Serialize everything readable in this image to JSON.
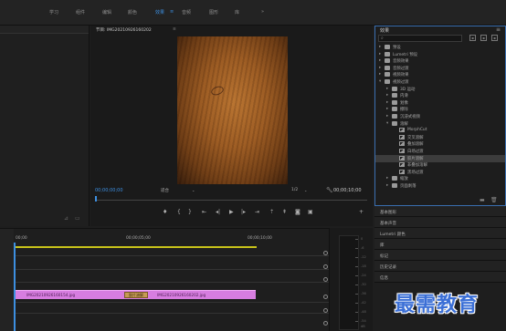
{
  "workspaces": [
    {
      "label": "学习",
      "active": false
    },
    {
      "label": "组件",
      "active": false
    },
    {
      "label": "编辑",
      "active": false
    },
    {
      "label": "颜色",
      "active": false
    },
    {
      "label": "效果",
      "active": true
    },
    {
      "label": "音频",
      "active": false
    },
    {
      "label": "图形",
      "active": false
    },
    {
      "label": "库",
      "active": false
    }
  ],
  "workspaces_more": "»",
  "monitor": {
    "tab_label": "节目: IMG20210926160202",
    "tab_close": "≡",
    "timecode_left": "00;00;00;00",
    "fit_label": "适合",
    "resolution_label": "1/2",
    "timecode_right": "00;00;10;00"
  },
  "effects": {
    "title": "效果",
    "menu": "≡",
    "search_value": "",
    "items": [
      {
        "level": 0,
        "type": "folder",
        "expanded": false,
        "label": "预设",
        "selected": false
      },
      {
        "level": 0,
        "type": "folder",
        "expanded": false,
        "label": "Lumetri 预设",
        "selected": false
      },
      {
        "level": 0,
        "type": "folder",
        "expanded": false,
        "label": "音频效果",
        "selected": false
      },
      {
        "level": 0,
        "type": "folder",
        "expanded": false,
        "label": "音频过渡",
        "selected": false
      },
      {
        "level": 0,
        "type": "folder",
        "expanded": false,
        "label": "视频效果",
        "selected": false
      },
      {
        "level": 0,
        "type": "folder",
        "expanded": true,
        "label": "视频过渡",
        "selected": false
      },
      {
        "level": 1,
        "type": "folder",
        "expanded": false,
        "label": "3D 运动",
        "selected": false
      },
      {
        "level": 1,
        "type": "folder",
        "expanded": false,
        "label": "内滑",
        "selected": false
      },
      {
        "level": 1,
        "type": "folder",
        "expanded": false,
        "label": "划像",
        "selected": false
      },
      {
        "level": 1,
        "type": "folder",
        "expanded": false,
        "label": "擦除",
        "selected": false
      },
      {
        "level": 1,
        "type": "folder",
        "expanded": false,
        "label": "沉浸式视频",
        "selected": false
      },
      {
        "level": 1,
        "type": "folder",
        "expanded": true,
        "label": "溶解",
        "selected": false
      },
      {
        "level": 2,
        "type": "transition",
        "expanded": false,
        "label": "MorphCut",
        "selected": false
      },
      {
        "level": 2,
        "type": "transition",
        "expanded": false,
        "label": "交叉溶解",
        "selected": false
      },
      {
        "level": 2,
        "type": "transition",
        "expanded": false,
        "label": "叠加溶解",
        "selected": false
      },
      {
        "level": 2,
        "type": "transition",
        "expanded": false,
        "label": "白场过渡",
        "selected": false
      },
      {
        "level": 2,
        "type": "transition",
        "expanded": false,
        "label": "胶片溶解",
        "selected": true
      },
      {
        "level": 2,
        "type": "transition",
        "expanded": false,
        "label": "非叠加溶解",
        "selected": false
      },
      {
        "level": 2,
        "type": "transition",
        "expanded": false,
        "label": "黑场过渡",
        "selected": false
      },
      {
        "level": 1,
        "type": "folder",
        "expanded": false,
        "label": "缩放",
        "selected": false
      },
      {
        "level": 1,
        "type": "folder",
        "expanded": false,
        "label": "页面剥落",
        "selected": false
      }
    ]
  },
  "right_panels": [
    "基本图形",
    "基本声音",
    "Lumetri 颜色",
    "库",
    "标记",
    "历史记录",
    "信息"
  ],
  "timeline": {
    "ruler": [
      "00;00",
      "00;00;05;00",
      "00;00;10;00"
    ],
    "clips": [
      {
        "label": "IMG20210926160154.jpg"
      },
      {
        "label": "IMG20210926160202.jpg"
      }
    ],
    "transition_label": "胶片溶解"
  },
  "audio_meter": {
    "ticks": [
      "0",
      "-6",
      "-12",
      "-18",
      "-24",
      "-30",
      "-36",
      "-42",
      "-48",
      "-54"
    ],
    "unit": "dB"
  },
  "watermark": "最需教育",
  "colors": {
    "accent": "#3d8fe0",
    "clip": "#d77de0",
    "workarea": "#c8c31a",
    "watermark": "#3b6fd6"
  }
}
